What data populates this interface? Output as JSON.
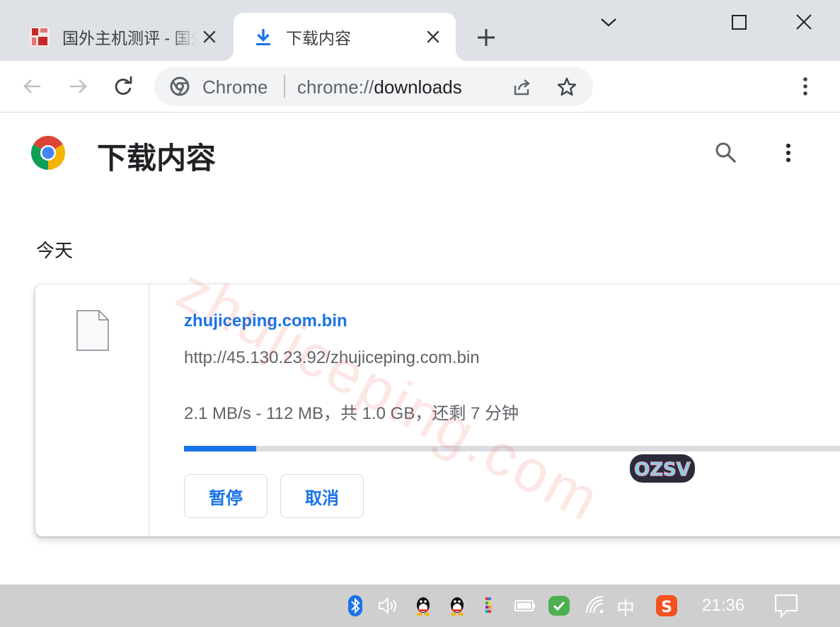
{
  "tabs": [
    {
      "title": "国外主机测评 - 国外VPS、国外服务器",
      "active": false
    },
    {
      "title": "下载内容",
      "active": true
    }
  ],
  "omnibox": {
    "site_label": "Chrome",
    "url_scheme": "chrome://",
    "url_host": "downloads"
  },
  "page": {
    "title": "下载内容",
    "section_date": "今天"
  },
  "download": {
    "file_name": "zhujiceping.com.bin",
    "url": "http://45.130.23.92/zhujiceping.com.bin",
    "status": "2.1 MB/s - 112 MB，共 1.0 GB，还剩 7 分钟",
    "progress_fraction": 0.11,
    "pause_label": "暂停",
    "cancel_label": "取消"
  },
  "watermark": "zhujiceping.com",
  "sticker_text": "OZSV",
  "taskbar": {
    "ime": "中",
    "clock": "21:36"
  },
  "colors": {
    "accent": "#1a73e8",
    "tabstrip": "#dee1e6",
    "taskbar": "#cfcfcf"
  }
}
